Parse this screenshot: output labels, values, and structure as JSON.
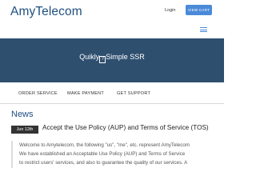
{
  "header": {
    "logo": "AmyTelecom",
    "login_label": "Login",
    "view_cart_label": "VIEW CART"
  },
  "hero": {
    "title_before": "Quikly",
    "title_glyph": "?",
    "title_after": "Simple SSR"
  },
  "menu": {
    "items": [
      {
        "label": "ORDER SERVICE"
      },
      {
        "label": "MAKE PAYMENT"
      },
      {
        "label": "GET SUPPORT"
      }
    ]
  },
  "news": {
    "heading": "News",
    "date": "Jun 12th",
    "title": "Accept the Use Policy (AUP) and Terms of Service (TOS)",
    "lines": [
      "Welcome to Amytelecom, the following \"us\", \"me\", etc. represent AmyTelecom",
      "We have established an Acceptable Use Policy (AUP) and Terms of Service",
      "to restrict users' services, and also to guarantee the quality of our services. A"
    ]
  },
  "colors": {
    "brand": "#1f4f80",
    "accent": "#4b8ad8",
    "hero_bg": "#2f4f6f"
  }
}
